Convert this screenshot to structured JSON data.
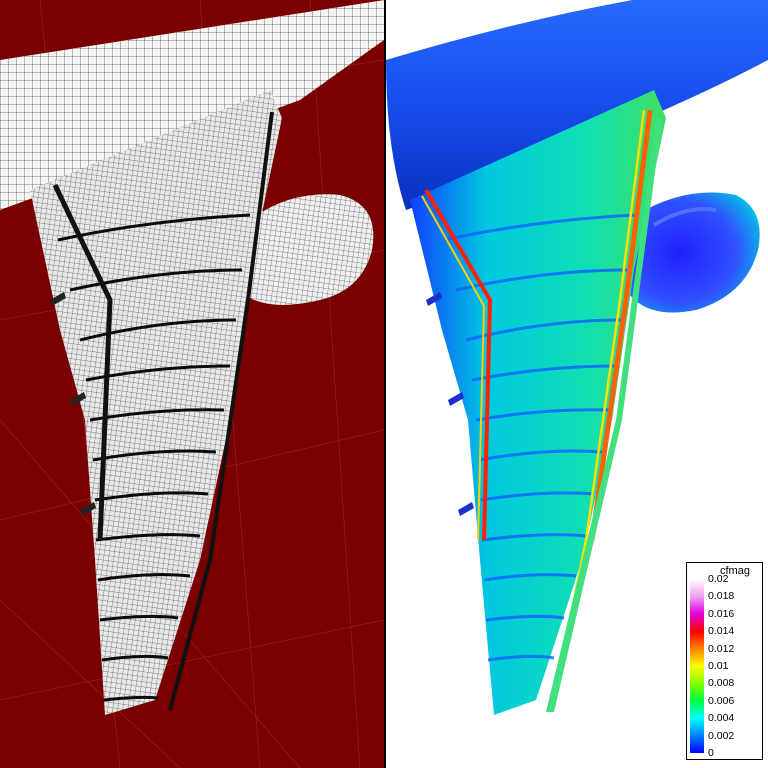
{
  "legend": {
    "title": "cfmag",
    "labels": [
      "0.02",
      "0.018",
      "0.016",
      "0.014",
      "0.012",
      "0.01",
      "0.008",
      "0.006",
      "0.004",
      "0.002",
      "0"
    ],
    "colors": [
      "#ffffff",
      "#f0a0f0",
      "#e000e0",
      "#ff0000",
      "#ff8000",
      "#ffff00",
      "#80ff00",
      "#00ff40",
      "#00ffff",
      "#0080ff",
      "#0000ff"
    ]
  },
  "colors": {
    "mesh_background": "#7a0000",
    "mesh_line": "#111111",
    "surface_low": "#1a3cff",
    "surface_mid": "#00e0c0",
    "surface_high": "#ff2000"
  }
}
